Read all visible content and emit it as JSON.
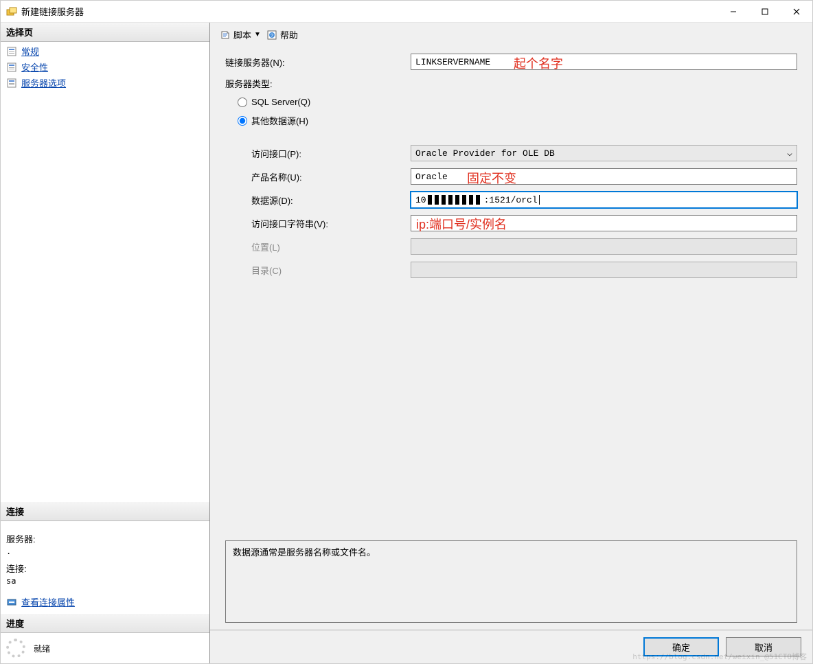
{
  "window": {
    "title": "新建链接服务器"
  },
  "winbtns": {
    "min": "minimize-icon",
    "max": "maximize-icon",
    "close": "close-icon"
  },
  "sidebar": {
    "pages_header": "选择页",
    "items": [
      {
        "label": "常规"
      },
      {
        "label": "安全性"
      },
      {
        "label": "服务器选项"
      }
    ],
    "connection_header": "连接",
    "server_label": "服务器:",
    "server_value": ".",
    "conn_label": "连接:",
    "conn_value": "sa",
    "view_props": "查看连接属性",
    "progress_header": "进度",
    "status": "就绪"
  },
  "toolbar": {
    "script_label": "脚本",
    "help_label": "帮助"
  },
  "form": {
    "linked_server": {
      "label": "链接服务器(N):",
      "value": "LINKSERVERNAME"
    },
    "server_type_label": "服务器类型:",
    "radios": {
      "sqlserver": "SQL Server(Q)",
      "other": "其他数据源(H)"
    },
    "provider": {
      "label": "访问接口(P):",
      "value": "Oracle Provider for OLE DB"
    },
    "product": {
      "label": "产品名称(U):",
      "value": "Oracle"
    },
    "datasource": {
      "label": "数据源(D):",
      "value_prefix": "10",
      "value_suffix": ":1521/orcl"
    },
    "provider_string": {
      "label": "访问接口字符串(V):",
      "value": ""
    },
    "location": {
      "label": "位置(L)",
      "value": ""
    },
    "catalog": {
      "label": "目录(C)",
      "value": ""
    },
    "hint": "数据源通常是服务器名称或文件名。"
  },
  "annotations": {
    "name_hint": "起个名字",
    "product_hint": "固定不变",
    "datasource_hint": "ip:端口号/实例名"
  },
  "footer": {
    "ok": "确定",
    "cancel": "取消"
  },
  "watermark": "https://blog.csdn.net/weixin_@51CTO博客"
}
